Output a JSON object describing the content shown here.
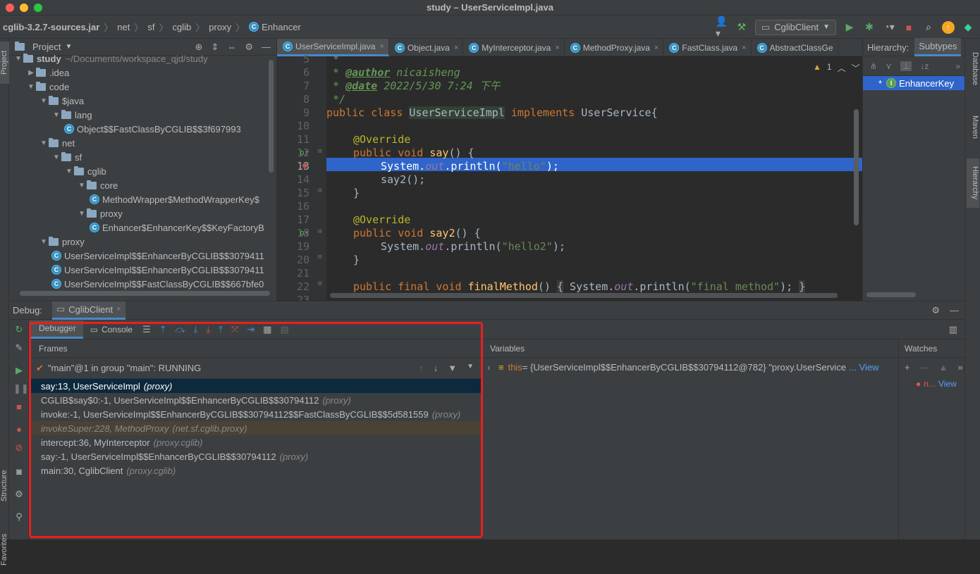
{
  "window": {
    "title": "study – UserServiceImpl.java"
  },
  "breadcrumb": [
    "cglib-3.2.7-sources.jar",
    "net",
    "sf",
    "cglib",
    "proxy",
    "Enhancer"
  ],
  "toolbar": {
    "run_config": "CglibClient"
  },
  "left_strip": {
    "project_tab": "Project",
    "structure_tab": "Structure",
    "favorites_tab": "Favorites"
  },
  "project": {
    "header": "Project",
    "root_name": "study",
    "root_path": "~/Documents/workspace_qjd/study",
    "tree": [
      {
        "label": "study",
        "type": "folder",
        "depth": 0
      },
      {
        "label": ".idea",
        "type": "folder",
        "depth": 1
      },
      {
        "label": "code",
        "type": "folder",
        "depth": 1
      },
      {
        "label": "$java",
        "type": "folder",
        "depth": 2
      },
      {
        "label": "lang",
        "type": "folder",
        "depth": 3
      },
      {
        "label": "Object$$FastClassByCGLIB$$3f697993",
        "type": "class",
        "depth": 4
      },
      {
        "label": "net",
        "type": "folder",
        "depth": 2
      },
      {
        "label": "sf",
        "type": "folder",
        "depth": 3
      },
      {
        "label": "cglib",
        "type": "folder",
        "depth": 4
      },
      {
        "label": "core",
        "type": "folder",
        "depth": 5
      },
      {
        "label": "MethodWrapper$MethodWrapperKey$",
        "type": "class",
        "depth": 6
      },
      {
        "label": "proxy",
        "type": "folder",
        "depth": 5
      },
      {
        "label": "Enhancer$EnhancerKey$$KeyFactoryB",
        "type": "class",
        "depth": 6
      },
      {
        "label": "proxy",
        "type": "folder",
        "depth": 2
      },
      {
        "label": "UserServiceImpl$$EnhancerByCGLIB$$3079411",
        "type": "class",
        "depth": 3
      },
      {
        "label": "UserServiceImpl$$EnhancerByCGLIB$$3079411",
        "type": "class",
        "depth": 3
      },
      {
        "label": "UserServiceImpl$$FastClassByCGLIB$$667bfe0",
        "type": "class",
        "depth": 3
      }
    ]
  },
  "editor": {
    "tabs": [
      "UserServiceImpl.java",
      "Object.java",
      "MyInterceptor.java",
      "MethodProxy.java",
      "FastClass.java",
      "AbstractClassGe"
    ],
    "warning_count": "1",
    "line_numbers": [
      "5",
      "6",
      "7",
      "8",
      "9",
      "10",
      "11",
      "12",
      "13",
      "14",
      "15",
      "16",
      "17",
      "18",
      "19",
      "20",
      "21",
      "22",
      "23"
    ]
  },
  "hierarchy": {
    "title": "Hierarchy:",
    "mode": "Subtypes",
    "item": "EnhancerKey"
  },
  "right_strip": {
    "database": "Database",
    "maven": "Maven",
    "hierarchy": "Hierarchy"
  },
  "debug": {
    "label": "Debug:",
    "session": "CglibClient",
    "tabs": {
      "debugger": "Debugger",
      "console": "Console"
    },
    "frames_title": "Frames",
    "thread": "\"main\"@1 in group \"main\": RUNNING",
    "frames": [
      {
        "method": "say:13, UserServiceImpl",
        "pkg": "(proxy)"
      },
      {
        "method": "CGLIB$say$0:-1, UserServiceImpl$$EnhancerByCGLIB$$30794112",
        "pkg": "(proxy)"
      },
      {
        "method": "invoke:-1, UserServiceImpl$$EnhancerByCGLIB$$30794112$$FastClassByCGLIB$$5d581559",
        "pkg": "(proxy)"
      },
      {
        "method": "invokeSuper:228, MethodProxy",
        "pkg": "(net.sf.cglib.proxy)"
      },
      {
        "method": "intercept:36, MyInterceptor",
        "pkg": "(proxy.cglib)"
      },
      {
        "method": "say:-1, UserServiceImpl$$EnhancerByCGLIB$$30794112",
        "pkg": "(proxy)"
      },
      {
        "method": "main:30, CglibClient",
        "pkg": "(proxy.cglib)"
      }
    ],
    "variables_title": "Variables",
    "variable": {
      "name": "this",
      "value": " = {UserServiceImpl$$EnhancerByCGLIB$$30794112@782} \"proxy.UserService",
      "more": "... View"
    },
    "watches_title": "Watches",
    "watch_item": "n...",
    "watch_view": "View"
  },
  "colors": {
    "accent": "#4a88c7",
    "selection": "#2f65ca",
    "highlight_box": "#e82020"
  }
}
